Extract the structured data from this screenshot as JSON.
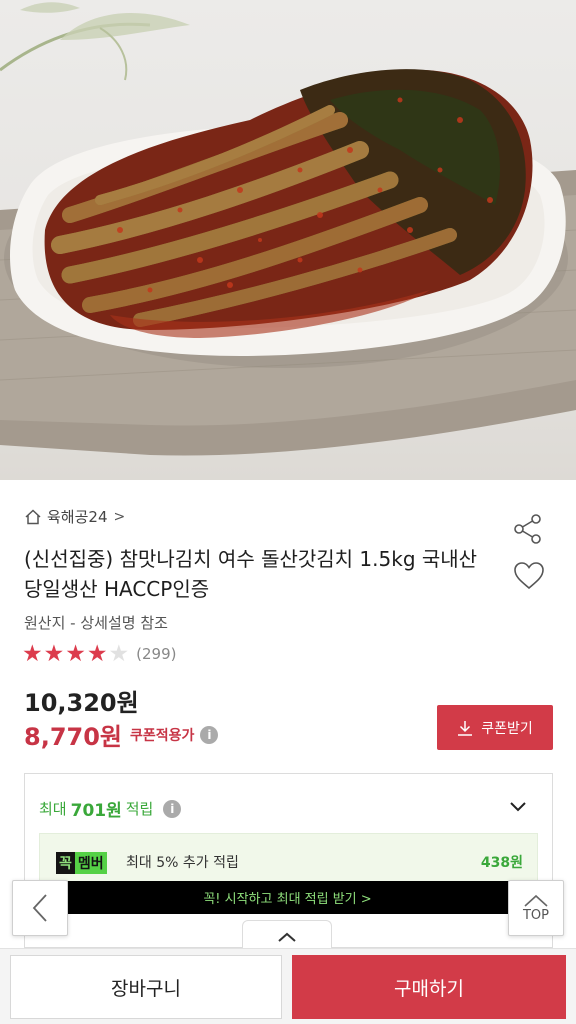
{
  "product": {
    "store_name": "육해공24",
    "store_chevron": ">",
    "title": "(신선집중) 참맛나김치 여수 돌산갓김치 1.5kg 국내산 당일생산 HACCP인증",
    "origin": "원산지 - 상세설명 참조",
    "rating": {
      "stars": 4,
      "max": 5,
      "review_count": "(299)"
    },
    "price_original": "10,320원",
    "price_coupon": "8,770원",
    "coupon_label": "쿠폰적용가",
    "coupon_button": "쿠폰받기"
  },
  "points": {
    "prefix": "최대",
    "amount": "701원",
    "suffix": "적립",
    "member": {
      "badge_1": "꼭",
      "badge_2": "멤버",
      "description": "최대 5% 추가 적립",
      "amount": "438원"
    }
  },
  "banner": {
    "text": "꼭! 시작하고 최대 적립 받기  >"
  },
  "floating": {
    "top_label": "TOP"
  },
  "bottom_bar": {
    "cart": "장바구니",
    "buy": "구매하기"
  },
  "colors": {
    "accent_red": "#d23b48",
    "points_green": "#3aa83a",
    "member_green": "#55d146"
  },
  "icons": [
    "home-icon",
    "share-icon",
    "heart-icon",
    "star-icon",
    "info-icon",
    "download-icon",
    "chevron-down-icon",
    "chevron-left-icon",
    "chevron-up-icon"
  ]
}
